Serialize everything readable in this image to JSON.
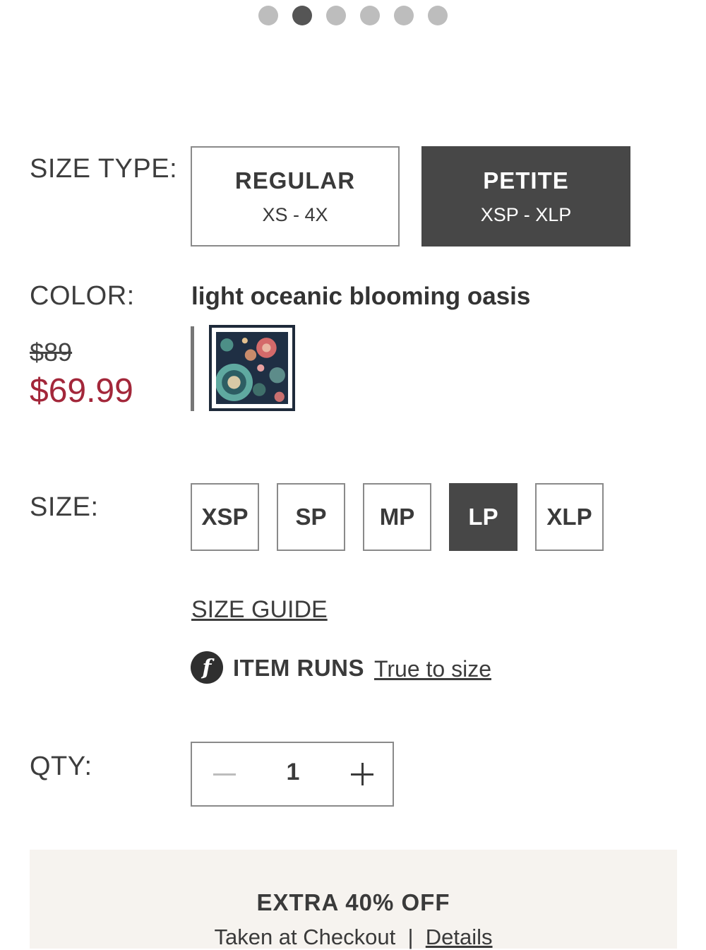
{
  "carousel": {
    "count": 6,
    "active_index": 1
  },
  "labels": {
    "size_type": "SIZE TYPE:",
    "color": "COLOR:",
    "size": "SIZE:",
    "qty": "QTY:"
  },
  "size_type": {
    "options": [
      {
        "title": "REGULAR",
        "range": "XS - 4X",
        "selected": false
      },
      {
        "title": "PETITE",
        "range": "XSP - XLP",
        "selected": true
      }
    ]
  },
  "color": {
    "name": "light oceanic blooming oasis"
  },
  "price": {
    "original": "$89",
    "sale": "$69.99"
  },
  "sizes": [
    {
      "label": "XSP",
      "selected": false
    },
    {
      "label": "SP",
      "selected": false
    },
    {
      "label": "MP",
      "selected": false
    },
    {
      "label": "LP",
      "selected": true
    },
    {
      "label": "XLP",
      "selected": false
    }
  ],
  "size_guide": "SIZE GUIDE",
  "fit": {
    "icon": "f",
    "label": "ITEM RUNS",
    "value": "True to size"
  },
  "qty": {
    "value": "1"
  },
  "promo": {
    "title": "EXTRA 40% OFF",
    "taken": "Taken at Checkout",
    "separator": "|",
    "details": "Details"
  },
  "colors": {
    "accent_dark": "#474747",
    "sale_red": "#a3273a",
    "promo_bg": "#f6f3ef"
  }
}
